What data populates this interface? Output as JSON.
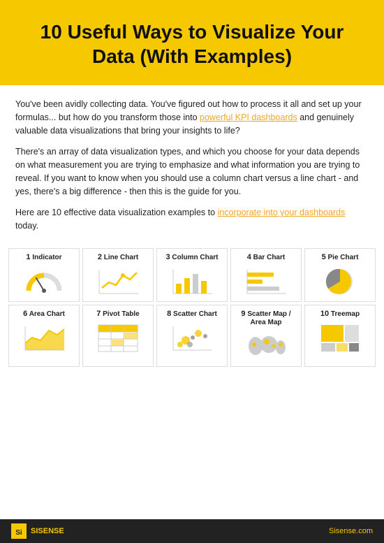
{
  "header": {
    "title": "10 Useful Ways to Visualize Your Data (With Examples)"
  },
  "content": {
    "para1": "You've been avidly collecting data. You've figured out how to process it all and set up your formulas... but how do you transform those into",
    "link1": "powerful KPI dashboards",
    "para1b": "and genuinely valuable data visualizations that bring your insights to life?",
    "para2": "There's an array of data visualization types, and which you choose for your data depends on what measurement you are trying to emphasize and what information you are trying to reveal. If you want to know when you should use a column chart versus a line chart - and yes, there's a big difference - then this is the guide for you.",
    "para3_pre": "Here are 10 effective data visualization examples to",
    "link2": "incorporate into your dashboards",
    "para3_post": "today."
  },
  "cards": [
    {
      "num": "1",
      "label": "Indicator",
      "type": "indicator"
    },
    {
      "num": "2",
      "label": "Line Chart",
      "type": "line"
    },
    {
      "num": "3",
      "label": "Column Chart",
      "type": "column"
    },
    {
      "num": "4",
      "label": "Bar Chart",
      "type": "bar"
    },
    {
      "num": "5",
      "label": "Pie Chart",
      "type": "pie"
    },
    {
      "num": "6",
      "label": "Area Chart",
      "type": "area"
    },
    {
      "num": "7",
      "label": "Pivot Table",
      "type": "pivot"
    },
    {
      "num": "8",
      "label": "Scatter Chart",
      "type": "scatter"
    },
    {
      "num": "9",
      "label": "Scatter Map / Area Map",
      "type": "map"
    },
    {
      "num": "10",
      "label": "Treemap",
      "type": "treemap"
    }
  ],
  "footer": {
    "logo_text": "SISENSE",
    "url": "Sisense.com"
  }
}
